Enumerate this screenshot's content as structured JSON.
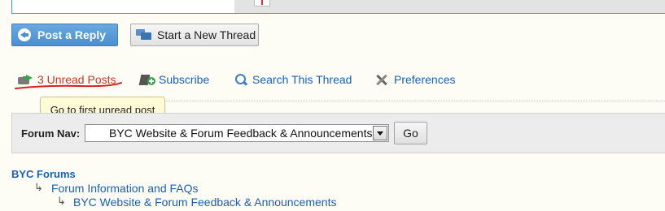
{
  "toolbar": {
    "post_reply_label": "Post a Reply",
    "new_thread_label": "Start a New Thread"
  },
  "thread_tools": {
    "unread_posts_label": "3 Unread Posts",
    "subscribe_label": "Subscribe",
    "search_thread_label": "Search This Thread",
    "preferences_label": "Preferences"
  },
  "tooltip": {
    "text": "Go to first unread post"
  },
  "forum_nav": {
    "label": "Forum Nav:",
    "selected": "BYC Website & Forum Feedback & Announcements",
    "go_label": "Go"
  },
  "breadcrumbs": {
    "root": "BYC Forums",
    "level1": "Forum Information and FAQs",
    "level2": "BYC Website & Forum Feedback & Announcements",
    "arrow": "↳"
  },
  "colors": {
    "link": "#1a5fb4",
    "reply_button": "#4a8fd0",
    "unread_text": "#c0392b",
    "tooltip_bg": "#fffbd6",
    "annotation_underline": "#d62020"
  }
}
